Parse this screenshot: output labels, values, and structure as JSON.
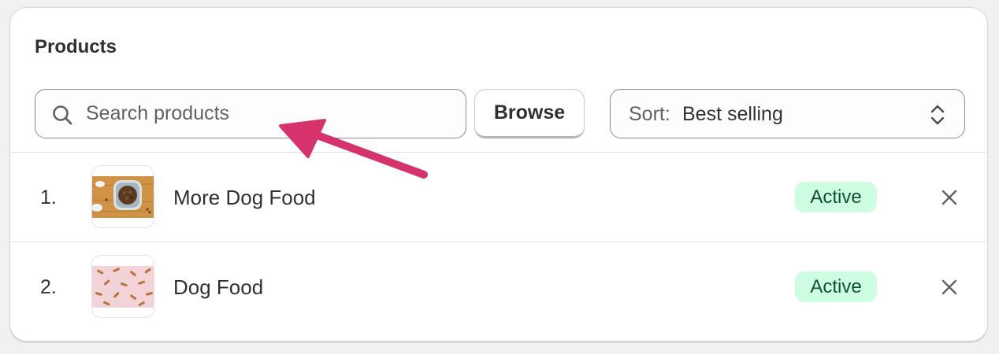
{
  "products": {
    "title": "Products",
    "search": {
      "placeholder": "Search products",
      "value": ""
    },
    "browse_label": "Browse",
    "sort": {
      "label": "Sort:",
      "value": "Best selling"
    },
    "items": [
      {
        "index": "1.",
        "name": "More Dog Food",
        "status": "Active",
        "thumbnail": "dog-food-bowl-image"
      },
      {
        "index": "2.",
        "name": "Dog Food",
        "status": "Active",
        "thumbnail": "dog-bones-pattern-image"
      }
    ]
  },
  "colors": {
    "status_active_bg": "#cdfee1",
    "status_active_text": "#0c5132",
    "annotation_arrow": "#d6336c"
  },
  "icons": [
    "search-icon",
    "sort-chevrons-icon",
    "close-icon",
    "annotation-arrow"
  ]
}
